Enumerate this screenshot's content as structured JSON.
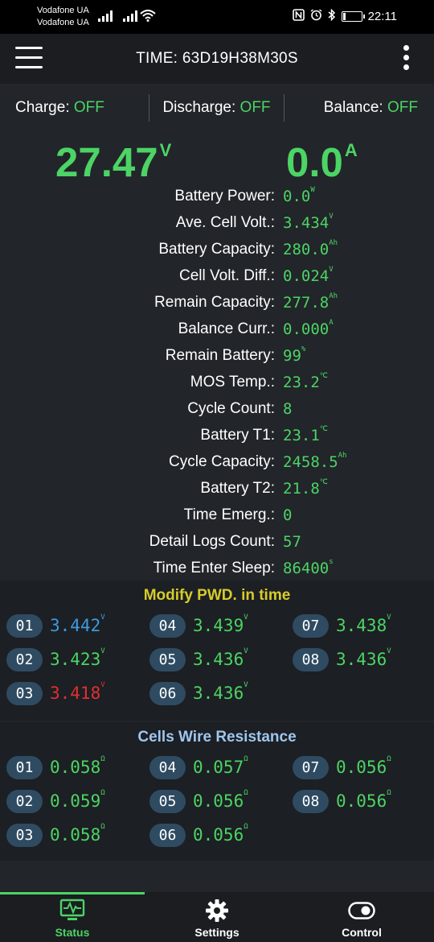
{
  "status_bar": {
    "carrier1": "Vodafone UA",
    "carrier2": "Vodafone UA",
    "time": "22:11",
    "battery_level": 0.15
  },
  "header": {
    "title": "TIME: 63D19H38M30S"
  },
  "states": {
    "charge_label": "Charge:",
    "charge_value": "OFF",
    "discharge_label": "Discharge:",
    "discharge_value": "OFF",
    "balance_label": "Balance:",
    "balance_value": "OFF"
  },
  "main": {
    "voltage": "27.47",
    "voltage_unit": "V",
    "current": "0.0",
    "current_unit": "A"
  },
  "info": [
    {
      "label": "Battery Power:",
      "value": "0.0",
      "unit": "W"
    },
    {
      "label": "Ave. Cell Volt.:",
      "value": "3.434",
      "unit": "V"
    },
    {
      "label": "Battery Capacity:",
      "value": "280.0",
      "unit": "Ah"
    },
    {
      "label": "Cell Volt. Diff.:",
      "value": "0.024",
      "unit": "V"
    },
    {
      "label": "Remain Capacity:",
      "value": "277.8",
      "unit": "Ah"
    },
    {
      "label": "Balance Curr.:",
      "value": "0.000",
      "unit": "A"
    },
    {
      "label": "Remain Battery:",
      "value": "99",
      "unit": "%"
    },
    {
      "label": "MOS Temp.:",
      "value": "23.2",
      "unit": "℃"
    },
    {
      "label": "Cycle Count:",
      "value": "8",
      "unit": ""
    },
    {
      "label": "Battery T1:",
      "value": "23.1",
      "unit": "℃"
    },
    {
      "label": "Cycle Capacity:",
      "value": "2458.5",
      "unit": "Ah"
    },
    {
      "label": "Battery T2:",
      "value": "21.8",
      "unit": "℃"
    },
    {
      "label": "Time Emerg.:",
      "value": "0",
      "unit": ""
    },
    {
      "label": "Detail Logs Count:",
      "value": "57",
      "unit": ""
    },
    {
      "label": "Time Enter Sleep:",
      "value": "86400",
      "unit": "s"
    }
  ],
  "voltages": {
    "title": "Modify PWD. in time",
    "title_color": "#d6cc2a",
    "unit": "V",
    "cells": [
      {
        "id": "01",
        "value": "3.442",
        "color": "#3d9be0"
      },
      {
        "id": "04",
        "value": "3.439",
        "color": "#4cd464"
      },
      {
        "id": "07",
        "value": "3.438",
        "color": "#4cd464"
      },
      {
        "id": "02",
        "value": "3.423",
        "color": "#4cd464"
      },
      {
        "id": "05",
        "value": "3.436",
        "color": "#4cd464"
      },
      {
        "id": "08",
        "value": "3.436",
        "color": "#4cd464"
      },
      {
        "id": "03",
        "value": "3.418",
        "color": "#e03030"
      },
      {
        "id": "06",
        "value": "3.436",
        "color": "#4cd464"
      }
    ]
  },
  "resistance": {
    "title": "Cells Wire Resistance",
    "title_color": "#9fc6ee",
    "unit": "Ω",
    "cells": [
      {
        "id": "01",
        "value": "0.058"
      },
      {
        "id": "04",
        "value": "0.057"
      },
      {
        "id": "07",
        "value": "0.056"
      },
      {
        "id": "02",
        "value": "0.059"
      },
      {
        "id": "05",
        "value": "0.056"
      },
      {
        "id": "08",
        "value": "0.056"
      },
      {
        "id": "03",
        "value": "0.058"
      },
      {
        "id": "06",
        "value": "0.056"
      }
    ]
  },
  "nav": {
    "status": "Status",
    "settings": "Settings",
    "control": "Control",
    "active_color": "#4cd464"
  },
  "icons": [
    "menu-icon",
    "kebab-menu-icon",
    "nfc-icon",
    "alarm-icon",
    "bluetooth-icon",
    "wifi-icon",
    "monitor-icon",
    "gear-icon",
    "toggle-icon"
  ]
}
